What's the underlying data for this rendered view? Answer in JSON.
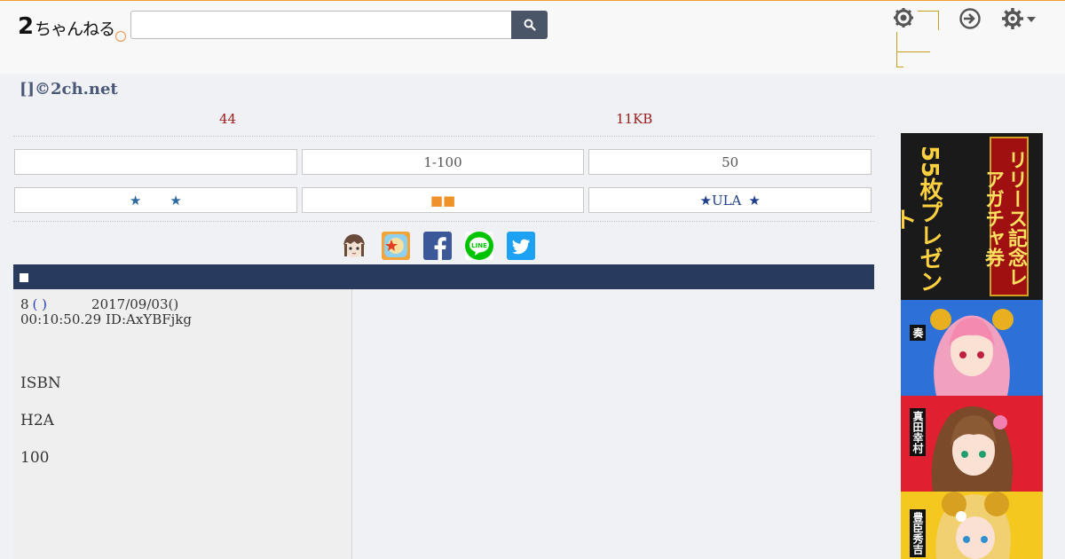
{
  "header": {
    "logo_big": "2",
    "logo_kana": "ちゃんねる",
    "search": {
      "value": "",
      "placeholder": ""
    },
    "user_menu_label": "",
    "colors": {
      "accent": "#f0a030",
      "search_button": "#4a5568"
    }
  },
  "site_title": "[]©2ch.net",
  "stats": {
    "count": "44",
    "size": "11KB"
  },
  "buttons_row1": [
    {
      "label": ""
    },
    {
      "label": "1-100"
    },
    {
      "label": "50"
    }
  ],
  "buttons_row2": [
    {
      "prefix": "★",
      "middle": "",
      "suffix": "★"
    },
    {
      "label": "■■"
    },
    {
      "prefix": "★",
      "middle": "ULA",
      "suffix": "★"
    }
  ],
  "share_icons": [
    "character-icon",
    "matome-icon",
    "facebook-icon",
    "line-icon",
    "twitter-icon"
  ],
  "share_line_label": "LINE",
  "thread_bar_marker": "■",
  "post": {
    "number": "8",
    "name_link": "( )",
    "date": "2017/09/03()",
    "time_id": "00:10:50.29 ID:AxYBFjkg",
    "lines": [
      "ISBN",
      "H2A",
      "100"
    ]
  },
  "ad": {
    "headline_left": "55枚プレゼント",
    "headline_right": "リリース記念レアガチャ券",
    "characters": [
      "奏",
      "真田幸村",
      "豊臣秀吉"
    ]
  }
}
